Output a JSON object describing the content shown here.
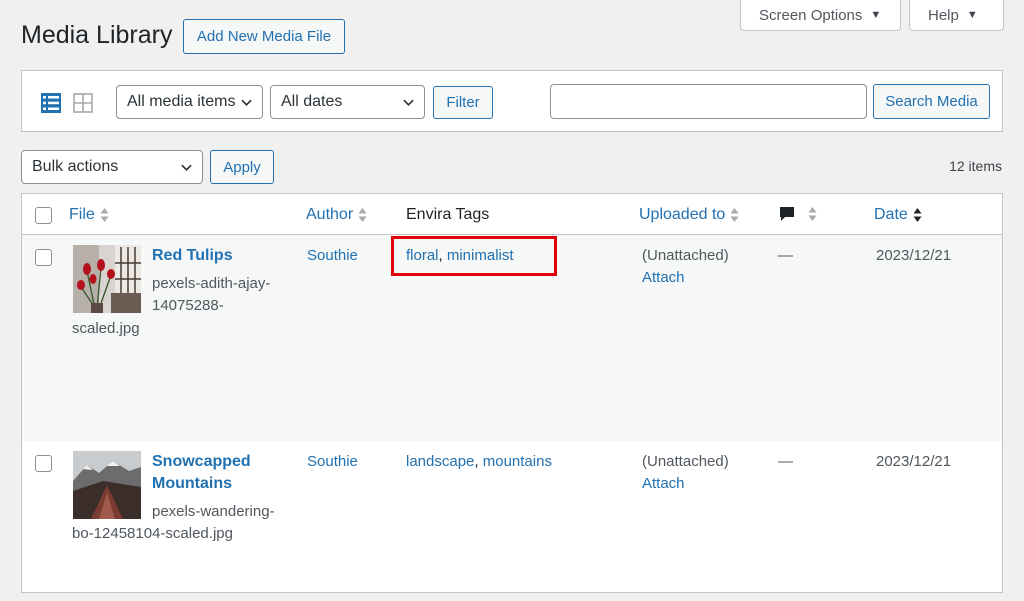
{
  "header": {
    "title": "Media Library",
    "add_new_label": "Add New Media File",
    "screen_options_label": "Screen Options",
    "help_label": "Help"
  },
  "filters": {
    "media_type_value": "All media items",
    "dates_value": "All dates",
    "filter_label": "Filter",
    "search_value": "",
    "search_button_label": "Search Media",
    "view_modes": [
      "list-view-icon",
      "grid-view-icon"
    ],
    "active_view": "list"
  },
  "bulk": {
    "select_value": "Bulk actions",
    "apply_label": "Apply",
    "items_count": "12 items"
  },
  "table": {
    "columns": {
      "file": "File",
      "author": "Author",
      "envira_tags": "Envira Tags",
      "uploaded_to": "Uploaded to",
      "comments_icon": "comment-bubble-icon",
      "date": "Date"
    },
    "rows": [
      {
        "title": "Red Tulips",
        "filename_lines": [
          "pexels-adith-ajay-",
          "14075288-",
          "scaled.jpg"
        ],
        "author": "Southie",
        "tags": [
          "floral",
          "minimalist"
        ],
        "uploaded_to": "(Unattached)",
        "attach_label": "Attach",
        "comments": "—",
        "date": "2023/12/21"
      },
      {
        "title_lines": [
          "Snowcapped",
          "Mountains"
        ],
        "filename_lines": [
          "pexels-wandering-",
          "bo-12458104-scaled.jpg"
        ],
        "author": "Southie",
        "tags": [
          "landscape",
          "mountains"
        ],
        "uploaded_to": "(Unattached)",
        "attach_label": "Attach",
        "comments": "—",
        "date": "2023/12/21"
      }
    ]
  },
  "colors": {
    "link": "#2271b1",
    "highlight": "#e3000b",
    "background": "#f0f0f1"
  }
}
